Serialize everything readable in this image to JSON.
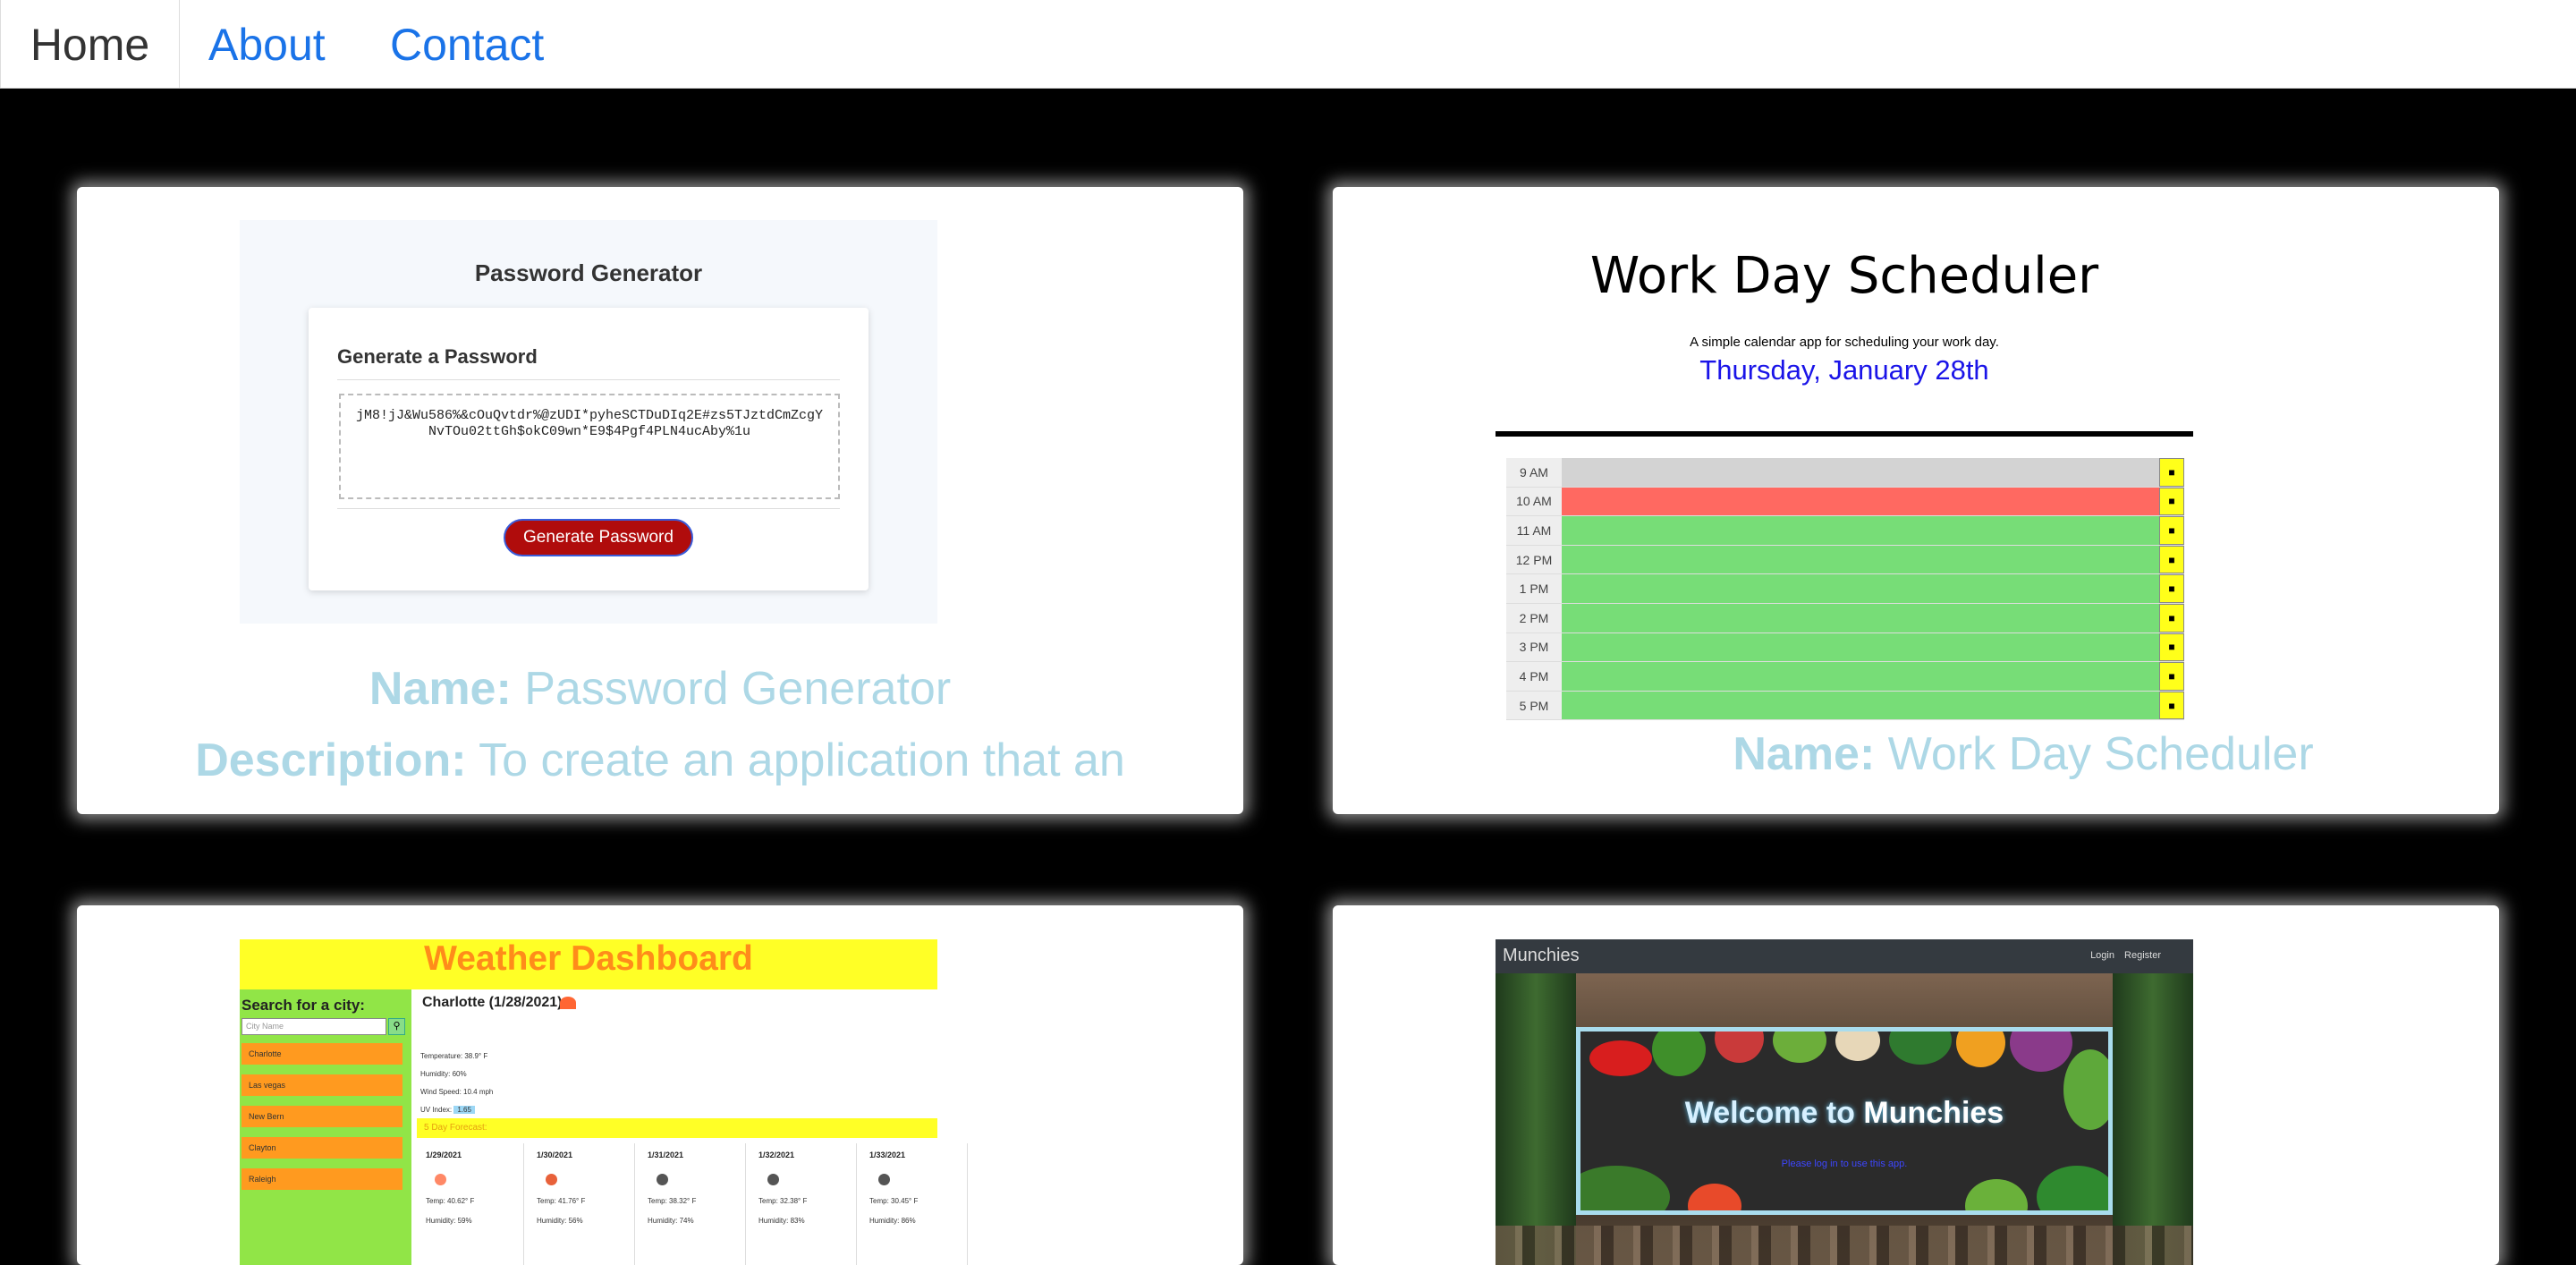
{
  "nav": {
    "home": "Home",
    "about": "About",
    "contact": "Contact"
  },
  "projects": [
    {
      "name_label": "Name:",
      "name": "Password Generator",
      "description_label": "Description:",
      "description": "To create an application that an",
      "screenshot": {
        "title": "Password Generator",
        "subtitle": "Generate a Password",
        "password": "jM8!jJ&Wu586%&cOuQvtdr%@zUDI*pyheSCTDuDIq2E#zs5TJztdCmZcgYNvTOu02ttGh$okC09wn*E9$4Pgf4PLN4ucAby%1u",
        "button": "Generate Password"
      }
    },
    {
      "name_label": "Name:",
      "name": "Work Day Scheduler",
      "screenshot": {
        "title": "Work Day Scheduler",
        "lead": "A simple calendar app for scheduling your work day.",
        "date": "Thursday, January 28th",
        "hours": [
          "9 AM",
          "10 AM",
          "11 AM",
          "12 PM",
          "1 PM",
          "2 PM",
          "3 PM",
          "4 PM",
          "5 PM"
        ],
        "states": [
          "past",
          "present",
          "future",
          "future",
          "future",
          "future",
          "future",
          "future",
          "future"
        ],
        "colors": {
          "past": "#d3d3d3",
          "present": "#ff6961",
          "future": "#77dd77"
        }
      }
    },
    {
      "screenshot": {
        "title": "Weather Dashboard",
        "search_label": "Search for a city:",
        "search_placeholder": "City Name",
        "cities": [
          "Charlotte",
          "Las vegas",
          "New Bern",
          "Clayton",
          "Raleigh"
        ],
        "current_title": "Charlotte (1/28/2021)",
        "temperature": "Temperature: 38.9° F",
        "humidity": "Humidity: 60%",
        "wind": "Wind Speed: 10.4 mph",
        "uv_label": "UV Index:",
        "uv_value": "1.65",
        "forecast_title": "5 Day Forecast:",
        "forecast": [
          {
            "date": "1/29/2021",
            "temp": "Temp: 40.62° F",
            "humidity": "Humidity: 59%"
          },
          {
            "date": "1/30/2021",
            "temp": "Temp: 41.76° F",
            "humidity": "Humidity: 56%"
          },
          {
            "date": "1/31/2021",
            "temp": "Temp: 38.32° F",
            "humidity": "Humidity: 74%"
          },
          {
            "date": "1/32/2021",
            "temp": "Temp: 32.38° F",
            "humidity": "Humidity: 83%"
          },
          {
            "date": "1/33/2021",
            "temp": "Temp: 30.45° F",
            "humidity": "Humidity: 86%"
          }
        ]
      }
    },
    {
      "screenshot": {
        "brand": "Munchies",
        "links": "Login Register",
        "welcome_prefix": "Welcome to ",
        "welcome_brand": "Munchies",
        "login_prompt": "Please log in to use this app."
      }
    }
  ]
}
